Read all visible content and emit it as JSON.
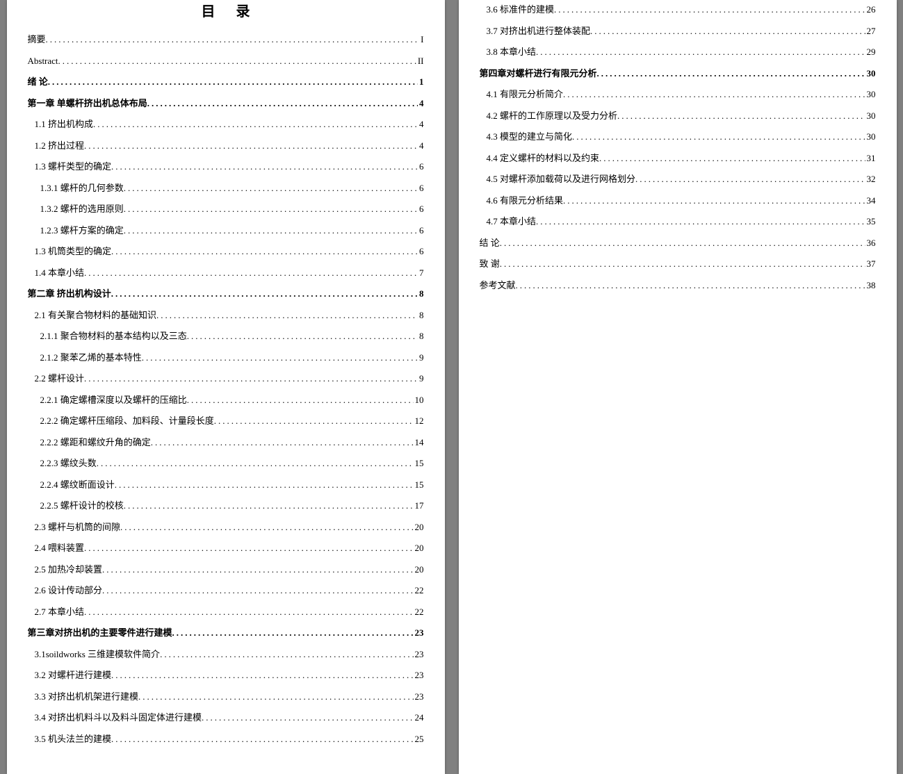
{
  "title": "目录",
  "leftEntries": [
    {
      "label": "摘要",
      "page": "I",
      "bold": false,
      "indent": 0
    },
    {
      "label": "Abstract",
      "page": "II",
      "bold": false,
      "indent": 0
    },
    {
      "label": "绪 论",
      "page": "1",
      "bold": true,
      "indent": 0
    },
    {
      "label": "第一章 单螺杆挤出机总体布局",
      "page": "4",
      "bold": true,
      "indent": 0
    },
    {
      "label": "1.1 挤出机构成",
      "page": "4",
      "bold": false,
      "indent": 1
    },
    {
      "label": "1.2 挤出过程",
      "page": "4",
      "bold": false,
      "indent": 1
    },
    {
      "label": "1.3 螺杆类型的确定",
      "page": "6",
      "bold": false,
      "indent": 1
    },
    {
      "label": "1.3.1 螺杆的几何参数",
      "page": "6",
      "bold": false,
      "indent": 2
    },
    {
      "label": "1.3.2 螺杆的选用原则",
      "page": "6",
      "bold": false,
      "indent": 2
    },
    {
      "label": "1.2.3 螺杆方案的确定",
      "page": "6",
      "bold": false,
      "indent": 2
    },
    {
      "label": "1.3 机筒类型的确定",
      "page": "6",
      "bold": false,
      "indent": 1
    },
    {
      "label": "1.4 本章小结",
      "page": "7",
      "bold": false,
      "indent": 1
    },
    {
      "label": "第二章 挤出机构设计",
      "page": "8",
      "bold": true,
      "indent": 0
    },
    {
      "label": "2.1 有关聚合物材料的基础知识",
      "page": "8",
      "bold": false,
      "indent": 1
    },
    {
      "label": "2.1.1 聚合物材料的基本结构以及三态",
      "page": "8",
      "bold": false,
      "indent": 2
    },
    {
      "label": "2.1.2 聚苯乙烯的基本特性",
      "page": "9",
      "bold": false,
      "indent": 2
    },
    {
      "label": "2.2 螺杆设计",
      "page": "9",
      "bold": false,
      "indent": 1
    },
    {
      "label": "2.2.1 确定螺槽深度以及螺杆的压缩比",
      "page": "10",
      "bold": false,
      "indent": 2
    },
    {
      "label": "2.2.2 确定螺杆压缩段、加料段、计量段长度",
      "page": "12",
      "bold": false,
      "indent": 2
    },
    {
      "label": "2.2.2 螺距和螺纹升角的确定",
      "page": "14",
      "bold": false,
      "indent": 2
    },
    {
      "label": "2.2.3 螺纹头数",
      "page": "15",
      "bold": false,
      "indent": 2
    },
    {
      "label": "2.2.4 螺纹断面设计",
      "page": "15",
      "bold": false,
      "indent": 2
    },
    {
      "label": "2.2.5 螺杆设计的校核",
      "page": "17",
      "bold": false,
      "indent": 2
    },
    {
      "label": "2.3 螺杆与机筒的间隙",
      "page": "20",
      "bold": false,
      "indent": 1
    },
    {
      "label": "2.4 喂料装置",
      "page": "20",
      "bold": false,
      "indent": 1
    },
    {
      "label": "2.5 加热冷却装置",
      "page": "20",
      "bold": false,
      "indent": 1
    },
    {
      "label": "2.6 设计传动部分",
      "page": "22",
      "bold": false,
      "indent": 1
    },
    {
      "label": "2.7 本章小结",
      "page": "22",
      "bold": false,
      "indent": 1
    },
    {
      "label": "第三章对挤出机的主要零件进行建模",
      "page": "23",
      "bold": true,
      "indent": 0
    },
    {
      "label": "3.1soildworks 三维建模软件简介",
      "page": "23",
      "bold": false,
      "indent": 1
    },
    {
      "label": "3.2 对螺杆进行建模",
      "page": "23",
      "bold": false,
      "indent": 1
    },
    {
      "label": "3.3 对挤出机机架进行建模",
      "page": "23",
      "bold": false,
      "indent": 1
    },
    {
      "label": "3.4 对挤出机料斗以及料斗固定体进行建模",
      "page": "24",
      "bold": false,
      "indent": 1
    },
    {
      "label": "3.5 机头法兰的建模",
      "page": "25",
      "bold": false,
      "indent": 1
    }
  ],
  "rightEntries": [
    {
      "label": "3.6 标准件的建模",
      "page": "26",
      "bold": false,
      "indent": 1
    },
    {
      "label": "3.7 对挤出机进行整体装配",
      "page": "27",
      "bold": false,
      "indent": 1
    },
    {
      "label": "3.8 本章小结",
      "page": "29",
      "bold": false,
      "indent": 1
    },
    {
      "label": "第四章对螺杆进行有限元分析",
      "page": "30",
      "bold": true,
      "indent": 0
    },
    {
      "label": "4.1 有限元分析简介",
      "page": "30",
      "bold": false,
      "indent": 1
    },
    {
      "label": "4.2 螺杆的工作原理以及受力分析",
      "page": "30",
      "bold": false,
      "indent": 1
    },
    {
      "label": "4.3 模型的建立与简化",
      "page": "30",
      "bold": false,
      "indent": 1
    },
    {
      "label": "4.4 定义螺杆的材料以及约束",
      "page": "31",
      "bold": false,
      "indent": 1
    },
    {
      "label": "4.5 对螺杆添加载荷以及进行网格划分",
      "page": "32",
      "bold": false,
      "indent": 1
    },
    {
      "label": "4.6 有限元分析结果",
      "page": "34",
      "bold": false,
      "indent": 1
    },
    {
      "label": "4.7 本章小结",
      "page": "35",
      "bold": false,
      "indent": 1
    },
    {
      "label": "结  论",
      "page": "36",
      "bold": false,
      "indent": 0
    },
    {
      "label": "致  谢",
      "page": "37",
      "bold": false,
      "indent": 0
    },
    {
      "label": "参考文献",
      "page": "38",
      "bold": false,
      "indent": 0
    }
  ]
}
